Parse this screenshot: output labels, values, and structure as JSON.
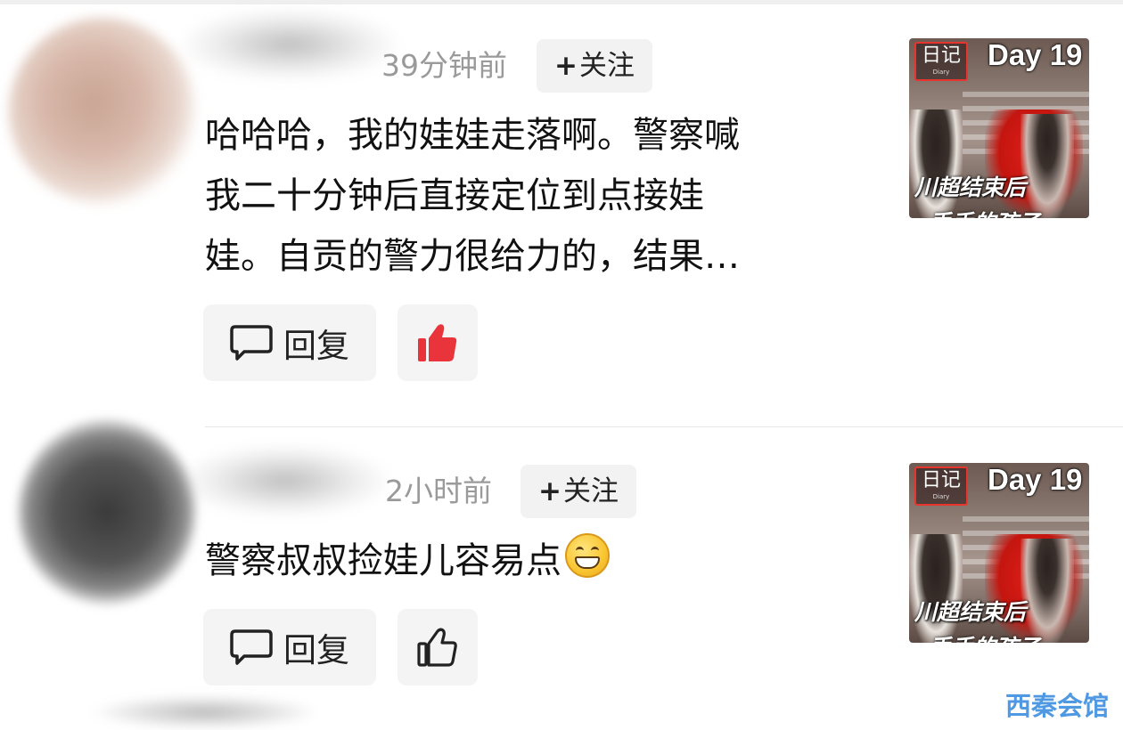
{
  "colors": {
    "like_active": "#e8343a",
    "follow_bg": "#f2f2f2",
    "text": "#111111",
    "muted": "#9a9a9a",
    "watermark": "#3d8fe0"
  },
  "video_thumb": {
    "badge_text": "日记",
    "badge_sub": "Diary",
    "day_label": "Day 19",
    "caption": "川超结束后",
    "caption_cut": "丢手的孩子"
  },
  "comments": [
    {
      "time": "39分钟前",
      "follow_label": "关注",
      "text_lines": [
        "哈哈哈，我的娃娃走落啊。警察喊",
        "我二十分钟后直接定位到点接娃",
        "娃。自贡的警力很给力的，结果…"
      ],
      "reply_label": "回复",
      "liked": true,
      "like_icon": "thumbs-up-filled-icon"
    },
    {
      "time": "2小时前",
      "follow_label": "关注",
      "text": "警察叔叔捡娃儿容易点",
      "emoji": "grinning-face-emoji",
      "reply_label": "回复",
      "liked": false,
      "like_icon": "thumbs-up-outline-icon"
    }
  ],
  "watermark": "西秦会馆"
}
